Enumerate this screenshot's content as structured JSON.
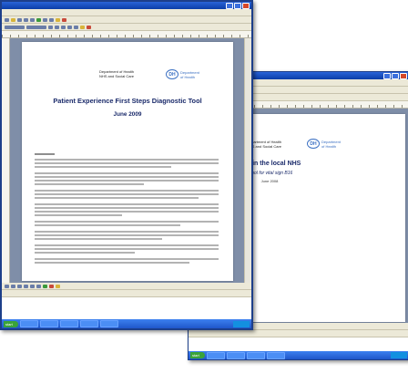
{
  "back_window": {
    "doc": {
      "title": "g Public confidence in the local NHS",
      "subtitle": "a tool for vital sign B16",
      "date": "June 2008"
    }
  },
  "front_window": {
    "doc": {
      "title": "Patient Experience First Steps Diagnostic Tool",
      "date": "June 2009"
    }
  },
  "brand": {
    "logo_mark": "DH",
    "logo_line1": "Department",
    "logo_line2": "of Health",
    "doh_line1": "Department of Health",
    "doh_line2": "NHS and Social Care"
  },
  "taskbar": {
    "start_label": "start"
  },
  "colors": {
    "titlebar": "#0b3ea8",
    "taskbar": "#1f56c9",
    "workspace": "#7f8ea8",
    "doc_heading": "#1a2a6a"
  }
}
